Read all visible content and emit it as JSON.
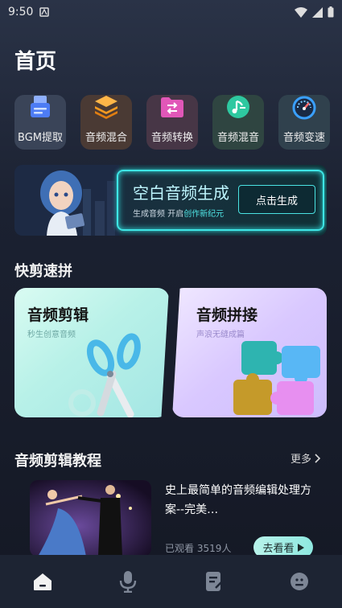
{
  "status_bar": {
    "time": "9:50"
  },
  "page_title": "首页",
  "tools": [
    {
      "label": "BGM提取",
      "icon": "document-stack-icon"
    },
    {
      "label": "音频混合",
      "icon": "layers-icon"
    },
    {
      "label": "音频转换",
      "icon": "folder-swap-icon"
    },
    {
      "label": "音频混音",
      "icon": "music-note-icon"
    },
    {
      "label": "音频变速",
      "icon": "speedometer-icon"
    }
  ],
  "banner": {
    "title": "空白音频生成",
    "subtitle_prefix": "生成音频 开启",
    "subtitle_highlight": "创作新纪元",
    "button": "点击生成"
  },
  "quick_section": {
    "title": "快剪速拼",
    "cards": [
      {
        "title": "音频剪辑",
        "subtitle": "秒生创意音频"
      },
      {
        "title": "音频拼接",
        "subtitle": "声浪无缝成篇"
      }
    ]
  },
  "tutorial_section": {
    "title": "音频剪辑教程",
    "more": "更多",
    "video": {
      "title": "史上最简单的音频编辑处理方案--完美…",
      "views": "已观看 3519人",
      "button": "去看看"
    }
  },
  "tabbar": [
    {
      "icon": "home-icon",
      "active": true
    },
    {
      "icon": "microphone-icon",
      "active": false
    },
    {
      "icon": "note-edit-icon",
      "active": false
    },
    {
      "icon": "profile-icon",
      "active": false
    }
  ],
  "colors": {
    "accent": "#3ee6e6",
    "background": "#1b2131"
  }
}
